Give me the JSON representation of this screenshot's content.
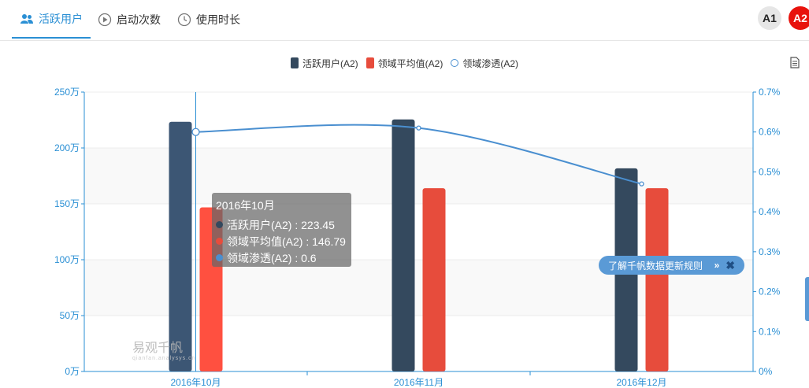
{
  "tabs": [
    {
      "label": "活跃用户",
      "icon": "users-icon",
      "active": true
    },
    {
      "label": "启动次数",
      "icon": "play-circle-icon",
      "active": false
    },
    {
      "label": "使用时长",
      "icon": "clock-icon",
      "active": false
    }
  ],
  "badges": [
    {
      "label": "A1",
      "bg": "#e6e6e6",
      "fg": "#222222"
    },
    {
      "label": "A2",
      "bg": "#e8120c",
      "fg": "#ffffff"
    }
  ],
  "tooltip": {
    "title": "2016年10月",
    "rows": [
      {
        "text": "活跃用户(A2) : 223.45",
        "color": "#34495e"
      },
      {
        "text": "领域平均值(A2) : 146.79",
        "color": "#e74c3c"
      },
      {
        "text": "领域渗透(A2) : 0.6",
        "color": "#4a8fd0"
      }
    ]
  },
  "notice": {
    "text": "了解千帆数据更新规则",
    "arrow": "»",
    "close": "✖"
  },
  "watermark": {
    "text": "易观千帆",
    "sub": "qianfan.analysys.cn"
  },
  "chart_data": {
    "type": "bar",
    "categories": [
      "2016年10月",
      "2016年11月",
      "2016年12月"
    ],
    "series": [
      {
        "name": "活跃用户(A2)",
        "kind": "bar",
        "axis": "left",
        "color": "#34495e",
        "values": [
          223.45,
          225.5,
          181.8
        ]
      },
      {
        "name": "领域平均值(A2)",
        "kind": "bar",
        "axis": "left",
        "color": "#e74c3c",
        "values": [
          146.79,
          164.0,
          164.0
        ]
      },
      {
        "name": "领域渗透(A2)",
        "kind": "line",
        "axis": "right",
        "color": "#4a8fd0",
        "values": [
          0.6,
          0.61,
          0.47
        ]
      }
    ],
    "left_axis": {
      "min": 0,
      "max": 250,
      "ticks": [
        "0万",
        "50万",
        "100万",
        "150万",
        "200万",
        "250万"
      ]
    },
    "right_axis": {
      "min": 0,
      "max": 0.7,
      "ticks": [
        "0%",
        "0.1%",
        "0.2%",
        "0.3%",
        "0.4%",
        "0.5%",
        "0.6%",
        "0.7%"
      ]
    },
    "highlight_index": 0,
    "legend_position": "top-center",
    "grid": true
  }
}
